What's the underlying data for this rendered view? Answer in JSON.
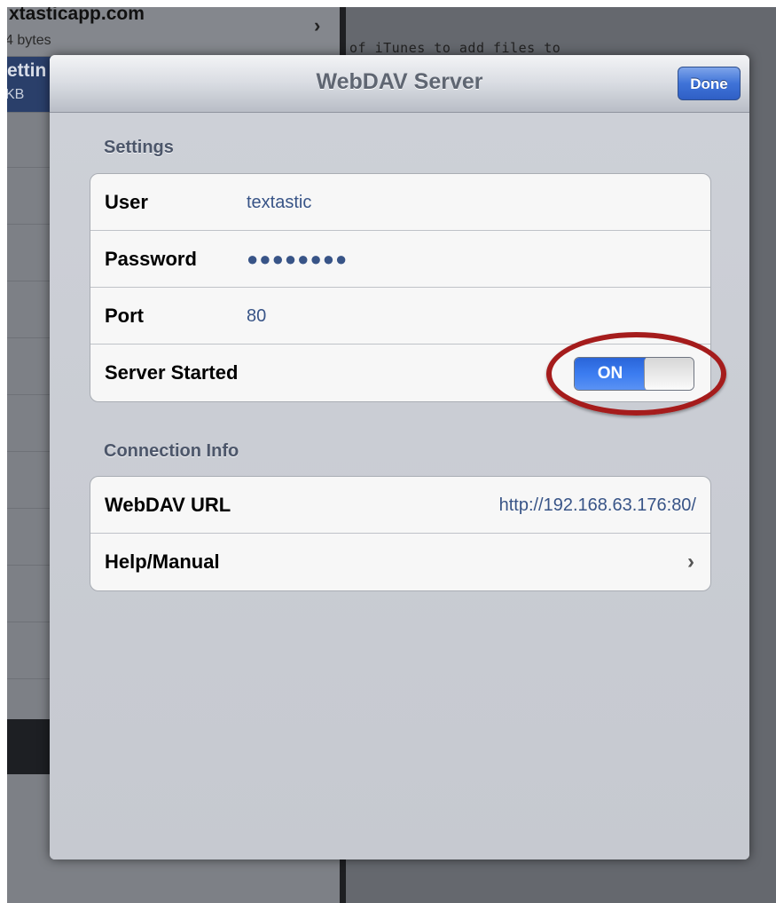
{
  "background": {
    "list_items": [
      {
        "title": "xtasticapp.com",
        "subtitle": "4 bytes"
      },
      {
        "title": "ettin",
        "subtitle": "KB"
      }
    ],
    "editor_text": "of iTunes to add files to"
  },
  "modal": {
    "title": "WebDAV Server",
    "done_label": "Done"
  },
  "settings": {
    "header": "Settings",
    "rows": [
      {
        "label": "User",
        "value": "textastic"
      },
      {
        "label": "Password",
        "value": "●●●●●●●●"
      },
      {
        "label": "Port",
        "value": "80"
      },
      {
        "label": "Server Started",
        "switch": "ON"
      }
    ]
  },
  "connection": {
    "header": "Connection Info",
    "rows": [
      {
        "label": "WebDAV URL",
        "value": "http://192.168.63.176:80/"
      },
      {
        "label": "Help/Manual"
      }
    ]
  },
  "icons": {
    "chevron": "chevron-right-icon"
  },
  "colors": {
    "accent": "#3b7cf0",
    "annotation": "#a51c1c",
    "value_text": "#385487"
  }
}
